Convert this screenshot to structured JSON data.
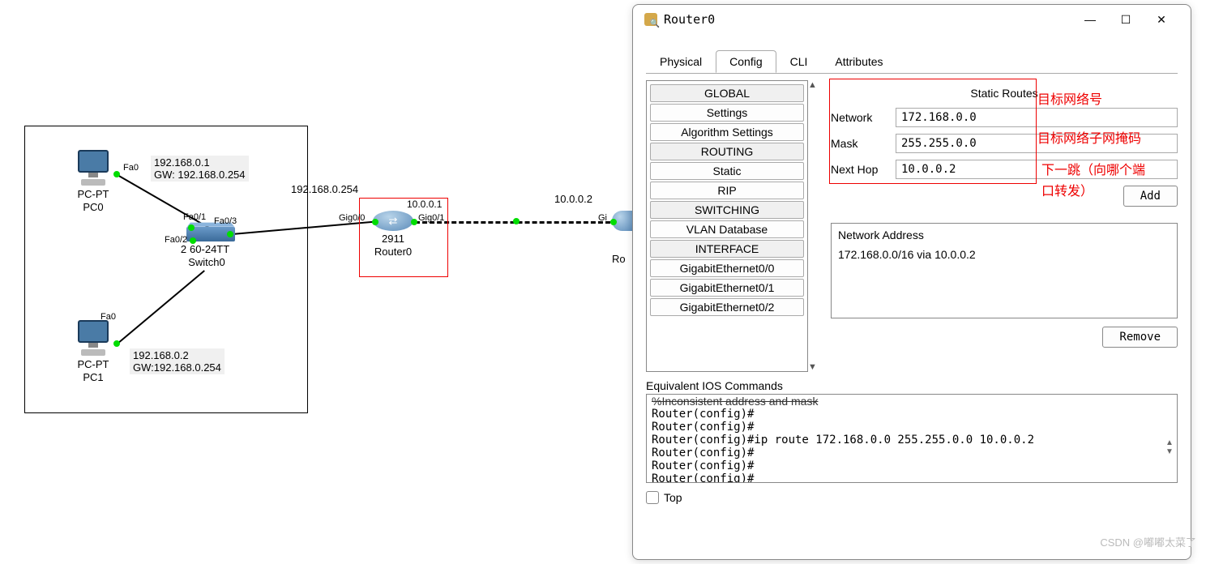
{
  "canvas": {
    "pc0": {
      "name": "PC-PT",
      "id": "PC0",
      "port": "Fa0",
      "ip": "192.168.0.1",
      "gw": "GW: 192.168.0.254"
    },
    "pc1": {
      "name": "PC-PT",
      "id": "PC1",
      "port": "Fa0",
      "ip": "192.168.0.2",
      "gw": "GW:192.168.0.254"
    },
    "switch": {
      "model": "60-24TT",
      "model_prefix": "2",
      "name": "Switch0",
      "p1": "Fa0/1",
      "p2": "Fa0/2",
      "p3": "Fa0/3"
    },
    "router0": {
      "model": "2911",
      "name": "Router0",
      "left_port": "Gig0/0",
      "right_port": "Gig0/1",
      "lan_ip": "192.168.0.254",
      "wan_ip": "10.0.0.1"
    },
    "router1_partial": {
      "name": "Ro",
      "port_prefix": "Gi",
      "wan_ip": "10.0.0.2"
    }
  },
  "window": {
    "title": "Router0",
    "tabs": [
      "Physical",
      "Config",
      "CLI",
      "Attributes"
    ],
    "nav_sections": [
      {
        "hdr": "GLOBAL",
        "items": [
          "Settings",
          "Algorithm Settings"
        ]
      },
      {
        "hdr": "ROUTING",
        "items": [
          "Static",
          "RIP"
        ]
      },
      {
        "hdr": "SWITCHING",
        "items": [
          "VLAN Database"
        ]
      },
      {
        "hdr": "INTERFACE",
        "items": [
          "GigabitEthernet0/0",
          "GigabitEthernet0/1",
          "GigabitEthernet0/2"
        ]
      }
    ],
    "form": {
      "title": "Static Routes",
      "network_label": "Network",
      "network_value": "172.168.0.0",
      "mask_label": "Mask",
      "mask_value": "255.255.0.0",
      "hop_label": "Next Hop",
      "hop_value": "10.0.0.2",
      "add": "Add",
      "list_header": "Network Address",
      "route_entry": "172.168.0.0/16 via 10.0.0.2",
      "remove": "Remove"
    },
    "ios": {
      "label": "Equivalent IOS Commands",
      "line0": "%Inconsistent address and mask",
      "lines": "Router(config)#\nRouter(config)#\nRouter(config)#ip route 172.168.0.0 255.255.0.0 10.0.0.2\nRouter(config)#\nRouter(config)#\nRouter(config)#"
    },
    "footer_top": "Top"
  },
  "annotations": {
    "a1": "目标网络号",
    "a2": "目标网络子网掩码",
    "a3": "下一跳（向哪个端口转发）"
  },
  "watermark": "CSDN @嘟嘟太菜了"
}
